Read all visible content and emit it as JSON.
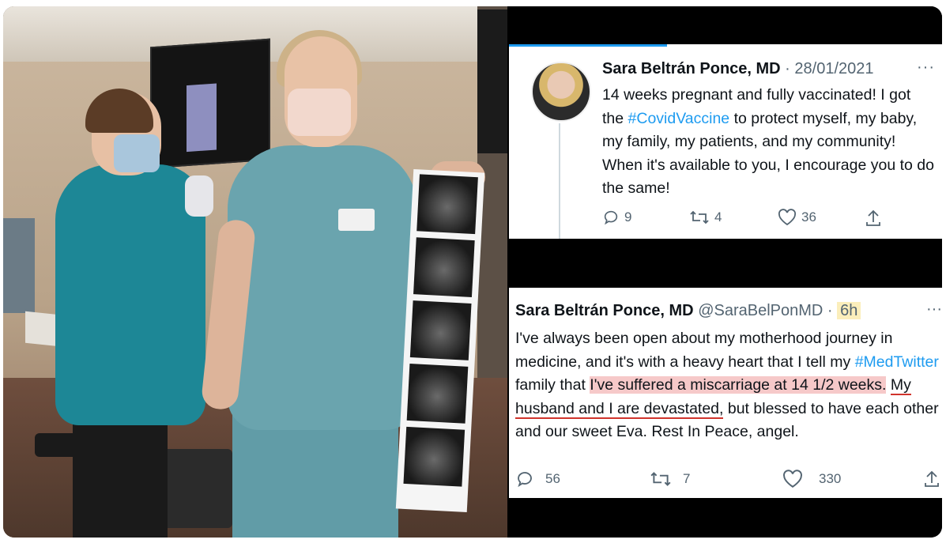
{
  "tweet1": {
    "author_name": "Sara Beltrán Ponce, MD",
    "separator": " · ",
    "date": "28/01/2021",
    "more": "···",
    "text_before_hashtag": "14 weeks pregnant and fully vaccinated! I got the ",
    "hashtag": "#CovidVaccine",
    "text_after_hashtag": " to protect myself, my baby, my family, my patients, and my community! When it's available to you, I encourage you to do the same!",
    "replies": "9",
    "retweets": "4",
    "likes": "36",
    "icons": [
      "reply-icon",
      "retweet-icon",
      "like-icon",
      "share-icon"
    ]
  },
  "tweet2": {
    "author_name": "Sara Beltrán Ponce, MD",
    "handle": "@SaraBelPonMD",
    "separator": " · ",
    "time": "6h",
    "more": "···",
    "text_part1": "I've always been open about my motherhood journey in medicine, and it's with a heavy heart that I tell my ",
    "hashtag": "#MedTwitter",
    "text_part2": " family that ",
    "highlighted": "I've suffered a miscarriage at 14 1/2 weeks.",
    "space": " ",
    "underlined": "My husband and I are devastated,",
    "text_part3": " but blessed to have each other and our sweet Eva. Rest In Peace, angel.",
    "replies": "56",
    "retweets": "7",
    "likes": "330",
    "highlight_color": "#f6c9c9",
    "underline_color": "#d0342c",
    "time_highlight_color": "#fbeebb"
  },
  "colors": {
    "link": "#1d9bf0",
    "muted": "#536471",
    "text": "#0f1419"
  }
}
